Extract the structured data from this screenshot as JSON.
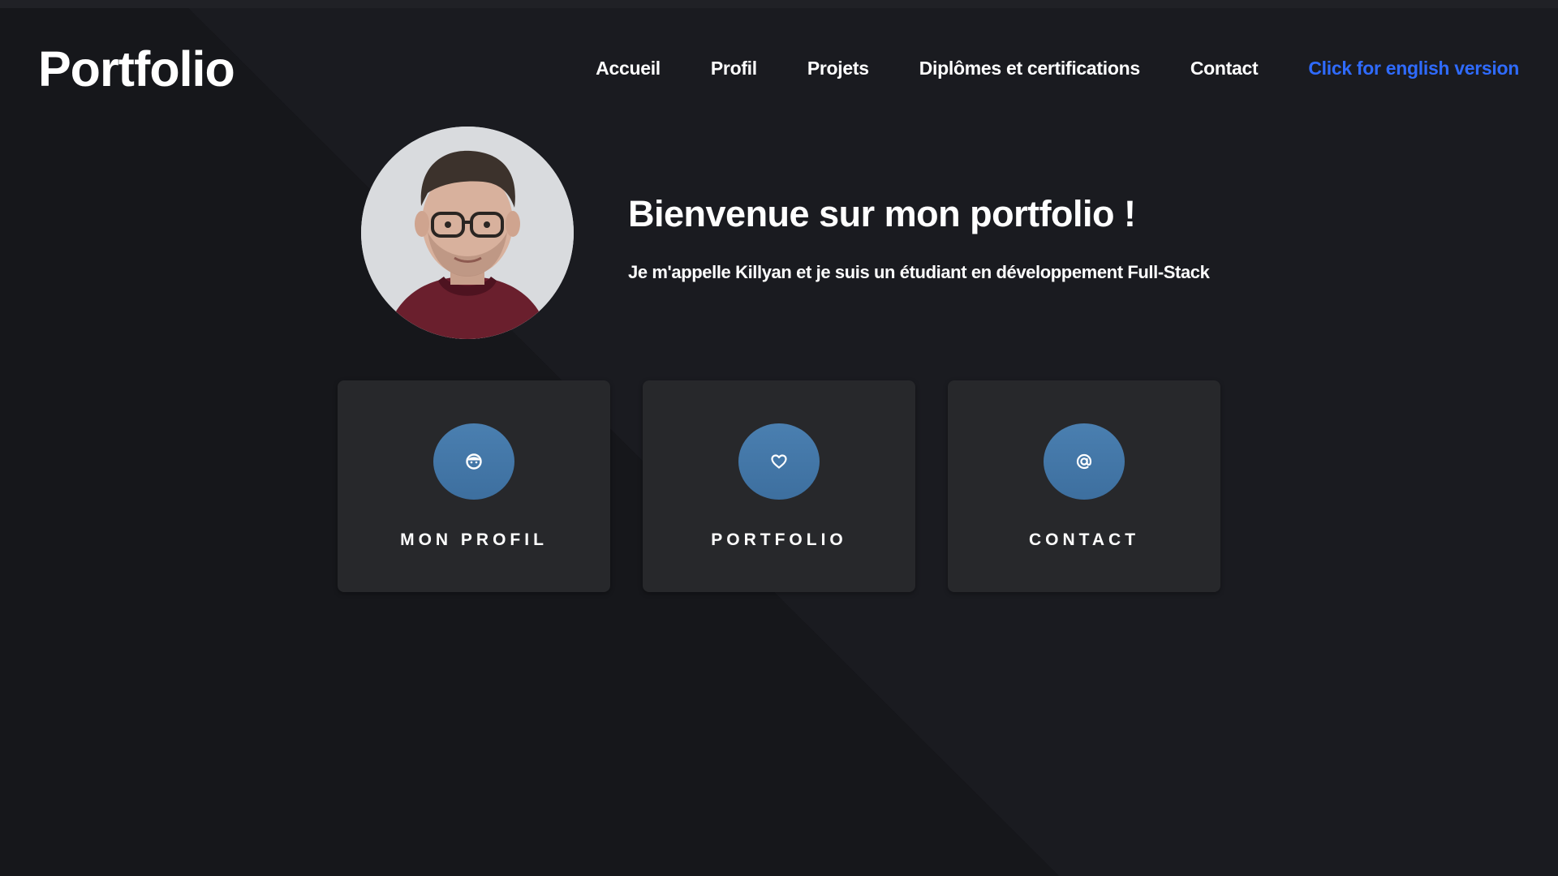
{
  "header": {
    "logo": "Portfolio",
    "nav": [
      {
        "label": "Accueil"
      },
      {
        "label": "Profil"
      },
      {
        "label": "Projets"
      },
      {
        "label": "Diplômes et certifications"
      },
      {
        "label": "Contact"
      }
    ],
    "lang_link": "Click for english version",
    "lang_link_color": "#2f6bff"
  },
  "hero": {
    "title": "Bienvenue sur mon portfolio !",
    "subtitle": "Je m'appelle Killyan et je suis un étudiant en développement Full-Stack"
  },
  "cards": [
    {
      "label": "MON PROFIL",
      "icon": "smiley-icon"
    },
    {
      "label": "PORTFOLIO",
      "icon": "heart-icon"
    },
    {
      "label": "CONTACT",
      "icon": "at-sign-icon"
    }
  ],
  "colors": {
    "background": "#16171b",
    "card": "#27282b",
    "icon_circle": "#4a7fb0"
  }
}
